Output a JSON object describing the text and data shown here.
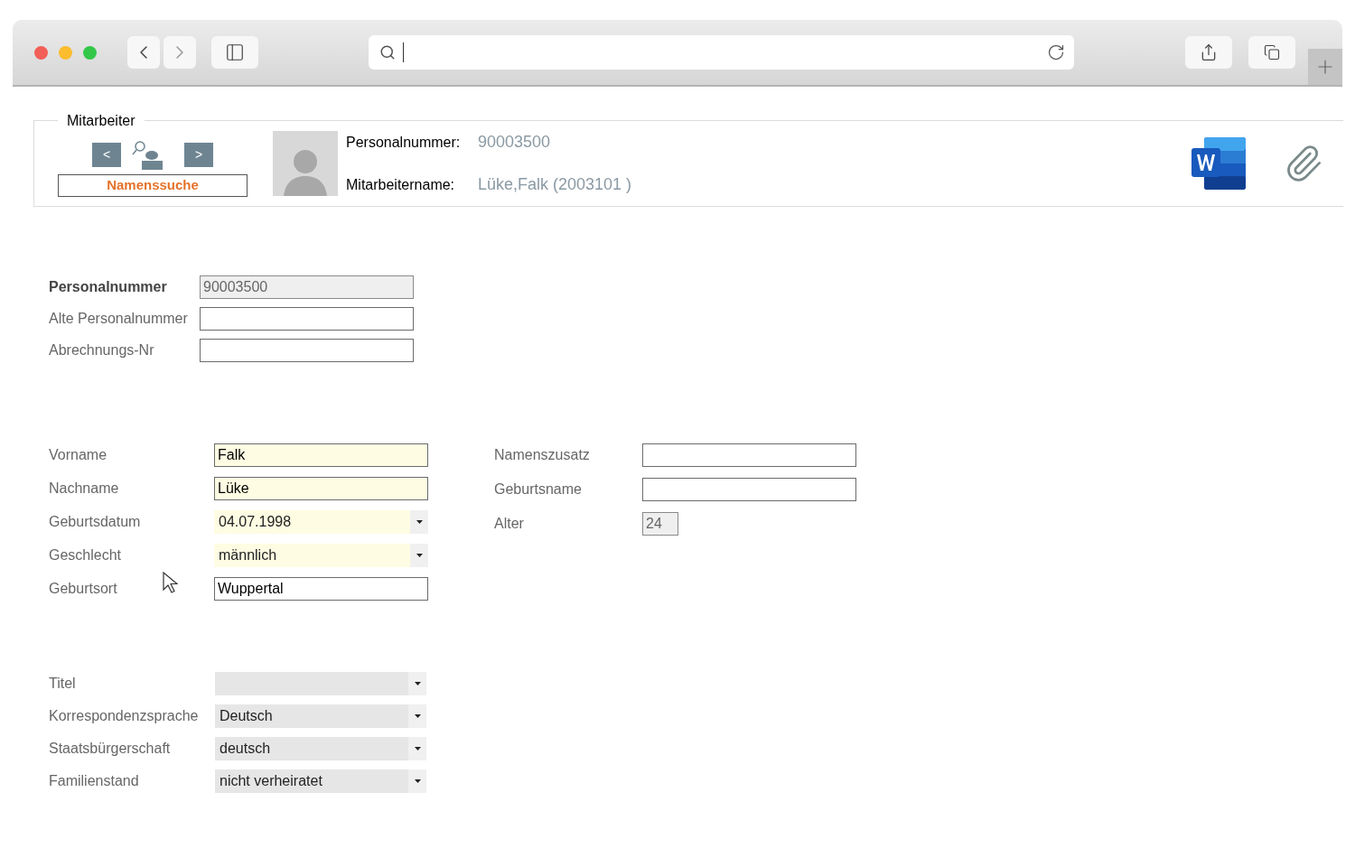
{
  "header": {
    "group_title": "Mitarbeiter",
    "search_button": "Namenssuche",
    "prev_button": "<",
    "next_button": ">",
    "info": [
      {
        "label": "Personalnummer:",
        "value": "90003500"
      },
      {
        "label": "Mitarbeitername:",
        "value": "Lüke,Falk (2003101 )"
      }
    ]
  },
  "id_fields": [
    {
      "label": "Personalnummer",
      "value": "90003500",
      "kind": "readonly",
      "emphasized": true
    },
    {
      "label": "Alte Personalnummer",
      "kind": "text",
      "emphasized": false
    },
    {
      "label": "Abrechnungs-Nr",
      "kind": "text",
      "emphasized": false
    }
  ],
  "person_fields": [
    {
      "label": "Vorname",
      "value": "Falk",
      "kind": "text",
      "required": true
    },
    {
      "label": "Nachname",
      "value": "Lüke",
      "kind": "text",
      "required": true
    },
    {
      "label": "Geburtsdatum",
      "value": "04.07.1998",
      "kind": "dropdown",
      "required": true
    },
    {
      "label": "Geschlecht",
      "value": "männlich",
      "kind": "dropdown",
      "required": true
    },
    {
      "label": "Geburtsort",
      "value": "Wuppertal",
      "kind": "text",
      "required": false
    }
  ],
  "extra_fields": [
    {
      "label": "Namenszusatz",
      "kind": "text"
    },
    {
      "label": "Geburtsname",
      "kind": "text"
    },
    {
      "label": "Alter",
      "value": "24",
      "kind": "readonly"
    }
  ],
  "option_fields": [
    {
      "label": "Titel",
      "kind": "dropdown"
    },
    {
      "label": "Korrespondenzsprache",
      "value": "Deutsch",
      "kind": "dropdown"
    },
    {
      "label": "Staatsbürgerschaft",
      "value": "deutsch",
      "kind": "dropdown"
    },
    {
      "label": "Familienstand",
      "value": "nicht verheiratet",
      "kind": "dropdown"
    }
  ]
}
